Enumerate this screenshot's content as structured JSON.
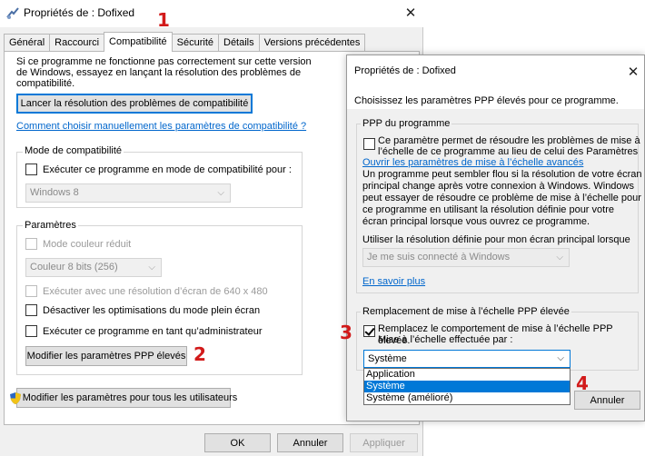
{
  "dialog1": {
    "title": "Propriétés de : Dofixed",
    "tabs": [
      "Général",
      "Raccourci",
      "Compatibilité",
      "Sécurité",
      "Détails",
      "Versions précédentes"
    ],
    "intro": [
      "Si ce programme ne fonctionne pas correctement sur cette version",
      "de Windows, essayez en lançant la résolution des problèmes de",
      "compatibilité."
    ],
    "troubleshoot_button": "Lancer la résolution des problèmes de compatibilité",
    "manual_link": "Comment choisir manuellement les paramètres de compatibilité ?",
    "compat_mode": {
      "title": "Mode de compatibilité",
      "checkbox": "Exécuter ce programme en mode de compatibilité pour :",
      "select_value": "Windows 8"
    },
    "settings": {
      "title": "Paramètres",
      "reduced_color": "Mode couleur réduit",
      "color_select": "Couleur 8 bits (256)",
      "run_640": "Exécuter avec une résolution d’écran de 640 x 480",
      "disable_fullscreen": "Désactiver les optimisations du mode plein écran",
      "run_admin": "Exécuter ce programme en tant qu’administrateur",
      "dpi_button": "Modifier les paramètres PPP élevés"
    },
    "all_users_button": "Modifier les paramètres pour tous les utilisateurs",
    "footer": {
      "ok": "OK",
      "cancel": "Annuler",
      "apply": "Appliquer"
    }
  },
  "dialog2": {
    "title": "Propriétés de : Dofixed",
    "heading": "Choisissez les paramètres PPP élevés pour ce programme.",
    "program_dpi": {
      "title": "PPP du programme",
      "checkbox_lines": [
        "Ce paramètre permet de résoudre les problèmes de mise à",
        "l’échelle de ce programme au lieu de celui des Paramètres"
      ],
      "link": "Ouvrir les paramètres de mise à l’échelle avancés",
      "desc": [
        "Un programme peut sembler flou si la résolution de votre écran",
        "principal change après votre connexion à Windows. Windows",
        "peut essayer de résoudre ce problème de mise à l’échelle pour",
        "ce programme en utilisant la résolution définie pour votre",
        "écran principal lorsque vous ouvrez ce programme."
      ],
      "use_resolution_label": "Utiliser la résolution définie pour mon écran principal lorsque",
      "select_value": "Je me suis connecté à Windows",
      "learn_more": "En savoir plus"
    },
    "override": {
      "title": "Remplacement de mise à l’échelle PPP élevée",
      "checkbox_lines": [
        "Remplacez le comportement de mise à l’échelle PPP élevée.",
        "Mise à l’échelle effectuée par :"
      ],
      "checked": true,
      "select_value": "Système",
      "options": [
        "Application",
        "Système",
        "Système (amélioré)"
      ],
      "selected_index": 1
    },
    "cancel": "Annuler"
  },
  "annotations": [
    "1",
    "2",
    "3",
    "4"
  ],
  "colors": {
    "accent": "#0078d7",
    "annotation": "#d21a1a",
    "link": "#0066cc"
  }
}
